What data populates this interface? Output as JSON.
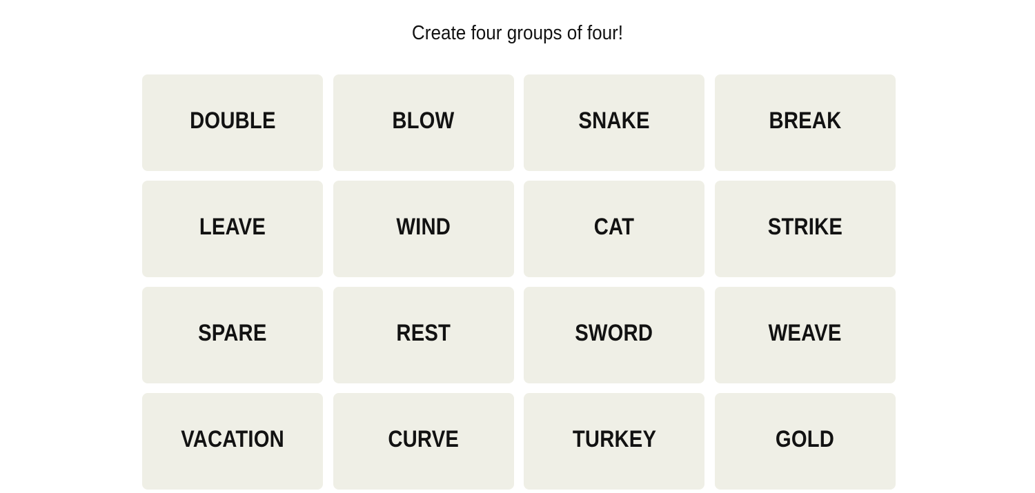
{
  "prompt": "Create four groups of four!",
  "tiles": [
    {
      "label": "DOUBLE"
    },
    {
      "label": "BLOW"
    },
    {
      "label": "SNAKE"
    },
    {
      "label": "BREAK"
    },
    {
      "label": "LEAVE"
    },
    {
      "label": "WIND"
    },
    {
      "label": "CAT"
    },
    {
      "label": "STRIKE"
    },
    {
      "label": "SPARE"
    },
    {
      "label": "REST"
    },
    {
      "label": "SWORD"
    },
    {
      "label": "WEAVE"
    },
    {
      "label": "VACATION"
    },
    {
      "label": "CURVE"
    },
    {
      "label": "TURKEY"
    },
    {
      "label": "GOLD"
    }
  ],
  "colors": {
    "tile_bg": "#efefe6",
    "text": "#121212"
  }
}
